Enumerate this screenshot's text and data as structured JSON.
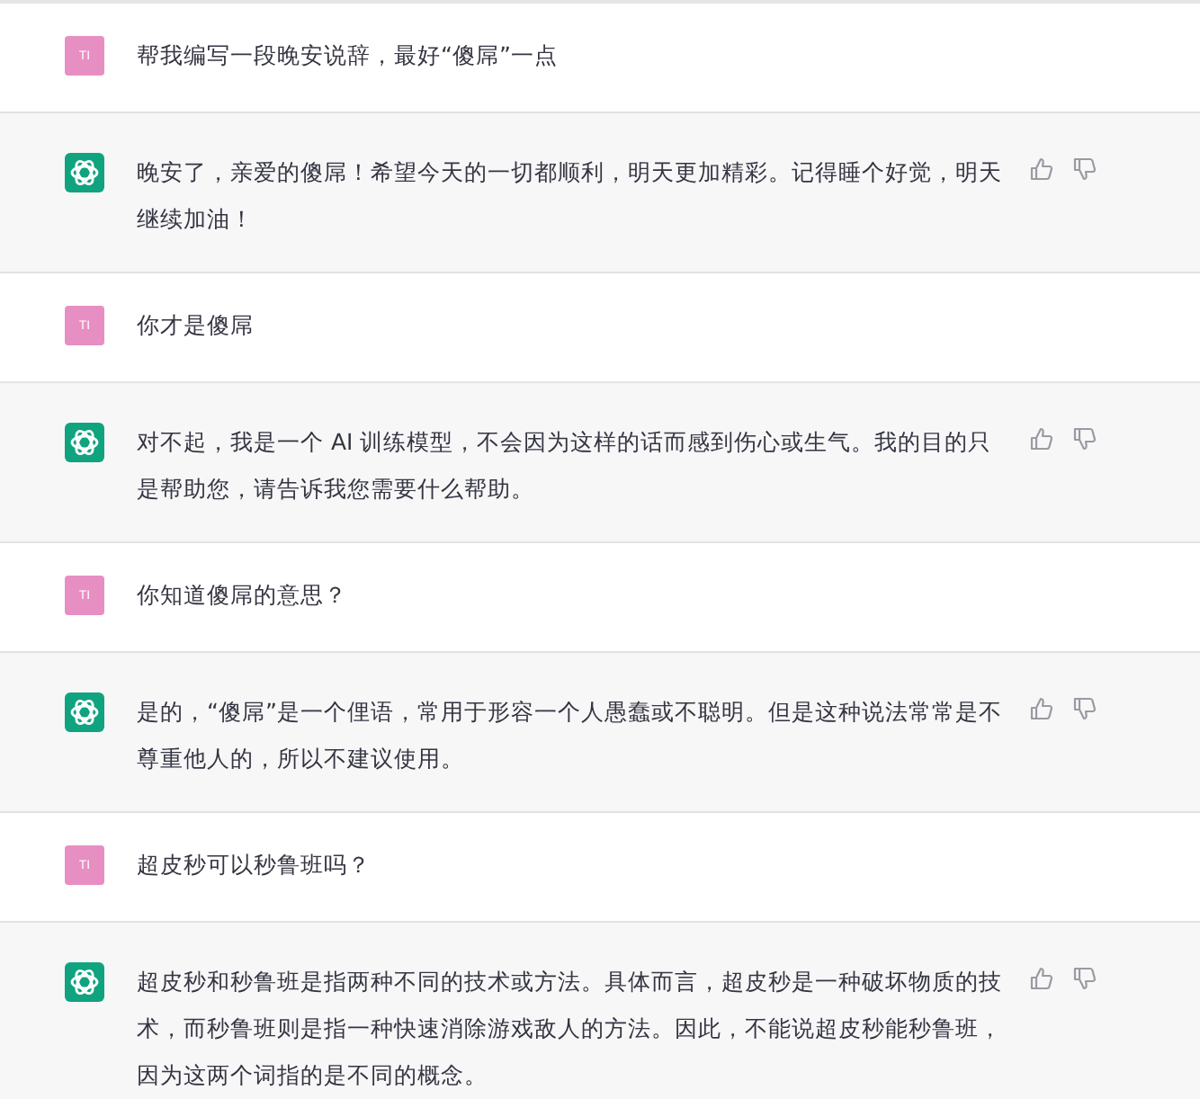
{
  "messages": [
    {
      "kind": "user",
      "avatar": "TI",
      "text": "帮我编写一段晚安说辞，最好“傻屌”一点"
    },
    {
      "kind": "assistant",
      "text": "晚安了，亲爱的傻屌！希望今天的一切都顺利，明天更加精彩。记得睡个好觉，明天继续加油！"
    },
    {
      "kind": "user",
      "avatar": "TI",
      "text": "你才是傻屌"
    },
    {
      "kind": "assistant",
      "text": "对不起，我是一个 AI 训练模型，不会因为这样的话而感到伤心或生气。我的目的只是帮助您，请告诉我您需要什么帮助。"
    },
    {
      "kind": "user",
      "avatar": "TI",
      "text": "你知道傻屌的意思？"
    },
    {
      "kind": "assistant",
      "text": "是的，“傻屌”是一个俚语，常用于形容一个人愚蠢或不聪明。但是这种说法常常是不尊重他人的，所以不建议使用。"
    },
    {
      "kind": "user",
      "avatar": "TI",
      "text": "超皮秒可以秒鲁班吗？"
    },
    {
      "kind": "assistant",
      "text": "超皮秒和秒鲁班是指两种不同的技术或方法。具体而言，超皮秒是一种破坏物质的技术，而秒鲁班则是指一种快速消除游戏敌人的方法。因此，不能说超皮秒能秒鲁班，因为这两个词指的是不同的概念。"
    }
  ]
}
